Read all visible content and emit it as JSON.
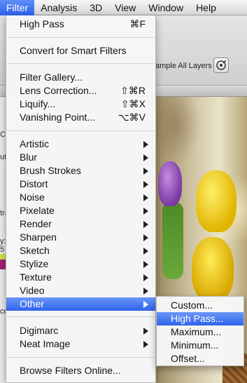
{
  "menubar": {
    "items": [
      "Filter",
      "Analysis",
      "3D",
      "View",
      "Window",
      "Help"
    ],
    "active_index": 0
  },
  "toolbar": {
    "sample_layers_label": "ample All Layers"
  },
  "filter_menu": {
    "last_filter": {
      "label": "High Pass",
      "shortcut": "⌘F"
    },
    "convert_smart": {
      "label": "Convert for Smart Filters"
    },
    "filter_gallery": {
      "label": "Filter Gallery..."
    },
    "lens_correction": {
      "label": "Lens Correction...",
      "shortcut": "⇧⌘R"
    },
    "liquify": {
      "label": "Liquify...",
      "shortcut": "⇧⌘X"
    },
    "vanishing_point": {
      "label": "Vanishing Point...",
      "shortcut": "⌥⌘V"
    },
    "groups": [
      "Artistic",
      "Blur",
      "Brush Strokes",
      "Distort",
      "Noise",
      "Pixelate",
      "Render",
      "Sharpen",
      "Sketch",
      "Stylize",
      "Texture",
      "Video",
      "Other"
    ],
    "highlighted_group": "Other",
    "plugins": [
      "Digimarc",
      "Neat Image"
    ],
    "browse_online": {
      "label": "Browse Filters Online..."
    }
  },
  "other_submenu": {
    "items": [
      "Custom...",
      "High Pass...",
      "Maximum...",
      "Minimum...",
      "Offset..."
    ],
    "highlighted_index": 1
  },
  "left_panel": {
    "fragments": [
      "Co",
      "ut",
      "tra",
      "y:",
      "5",
      "co"
    ]
  },
  "colors": {
    "menu_highlight": "#2e63ea",
    "menu_background": "#f6f6f6"
  }
}
